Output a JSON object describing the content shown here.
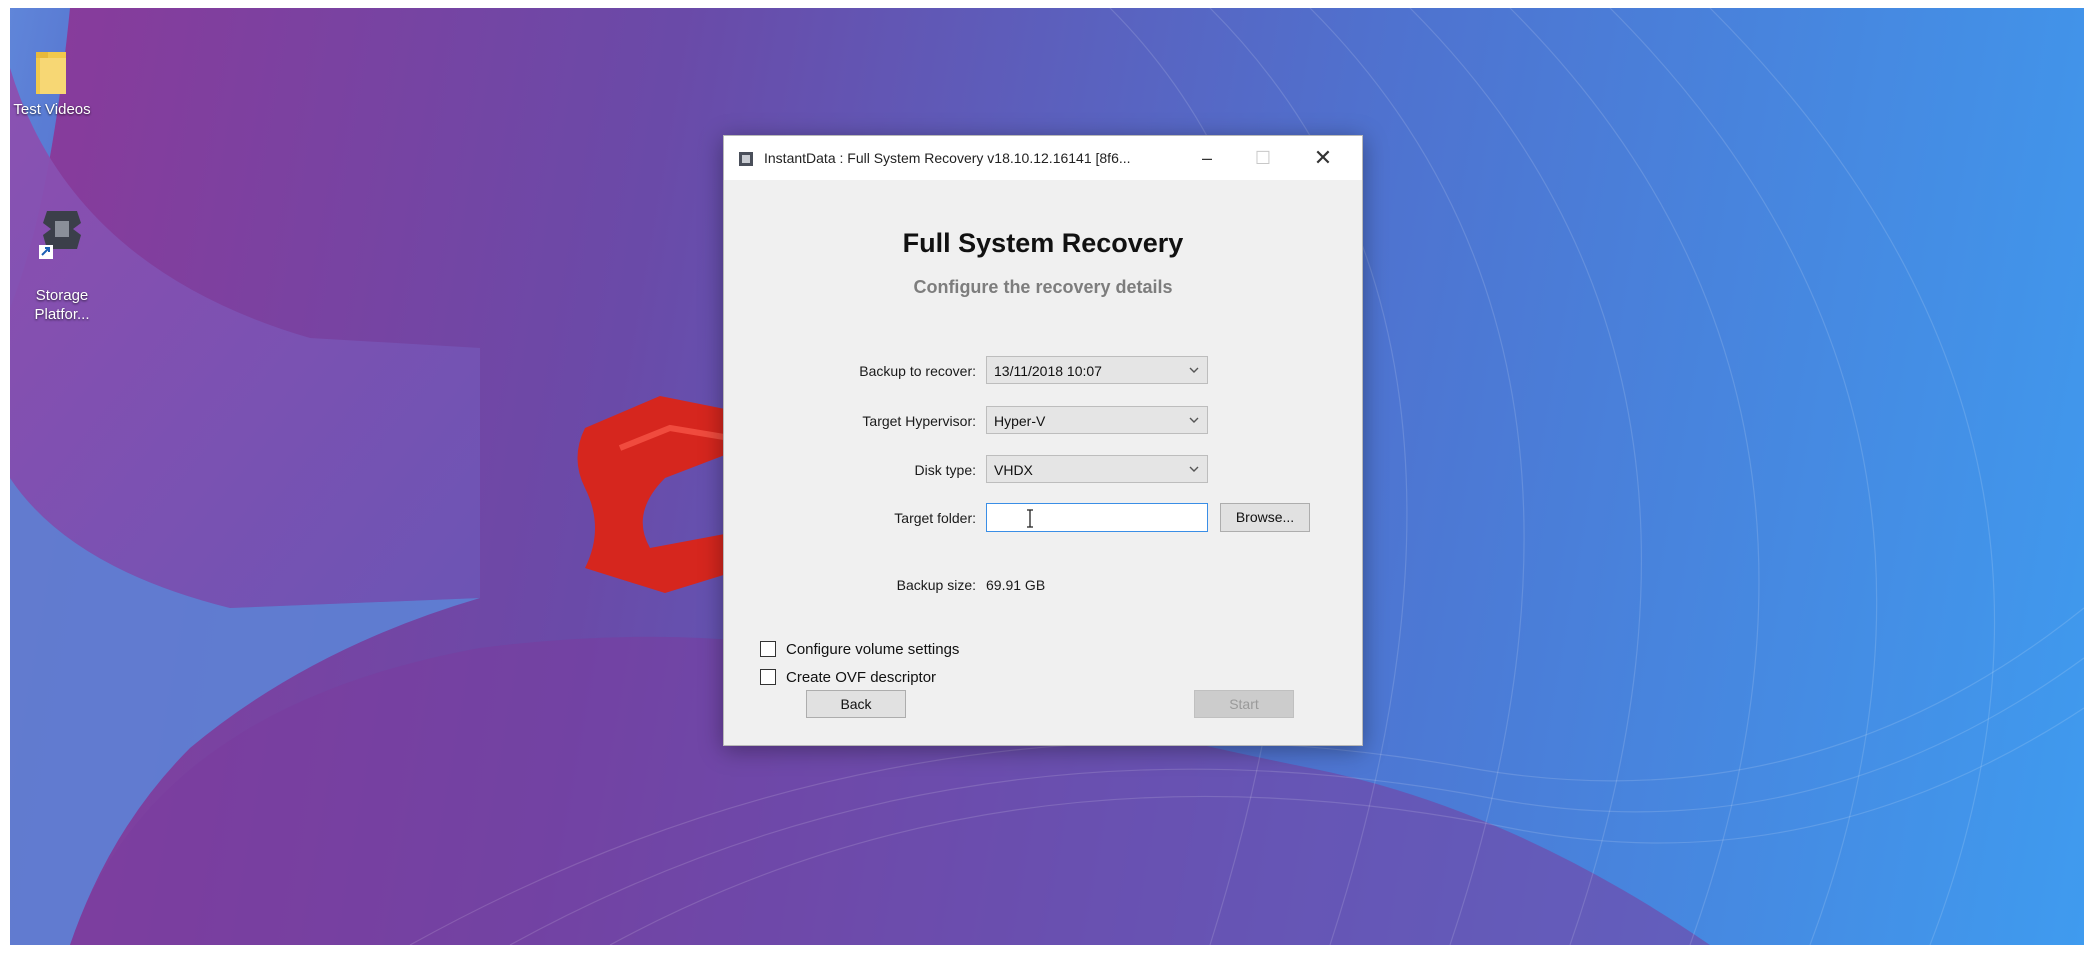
{
  "desktop": {
    "icons": [
      {
        "label": "Test Videos",
        "icon": "folder-icon"
      },
      {
        "label": "Storage\nPlatfor...",
        "icon": "storage-platform-shortcut-icon"
      }
    ]
  },
  "dialog": {
    "title": "InstantData : Full System Recovery v18.10.12.16141 [8f6...",
    "heading": "Full System Recovery",
    "subheading": "Configure the recovery details",
    "fields": {
      "backup": {
        "label": "Backup to recover:",
        "value": "13/11/2018 10:07"
      },
      "hypervisor": {
        "label": "Target Hypervisor:",
        "value": "Hyper-V"
      },
      "disk_type": {
        "label": "Disk type:",
        "value": "VHDX"
      },
      "target_folder": {
        "label": "Target folder:",
        "value": ""
      },
      "backup_size": {
        "label": "Backup size:",
        "value": "69.91 GB"
      }
    },
    "browse_label": "Browse...",
    "checkboxes": {
      "configure_volume": {
        "label": "Configure volume settings",
        "checked": false
      },
      "create_ovf": {
        "label": "Create OVF descriptor",
        "checked": false
      }
    },
    "back_label": "Back",
    "start_label": "Start",
    "window_controls": {
      "minimize": "–",
      "maximize": "☐",
      "close": "✕"
    }
  },
  "colors": {
    "accent_focus": "#3a8ee6",
    "logo_red": "#d6261e",
    "wallpaper_left": "#8a3a9a",
    "wallpaper_right": "#3f9bef"
  }
}
